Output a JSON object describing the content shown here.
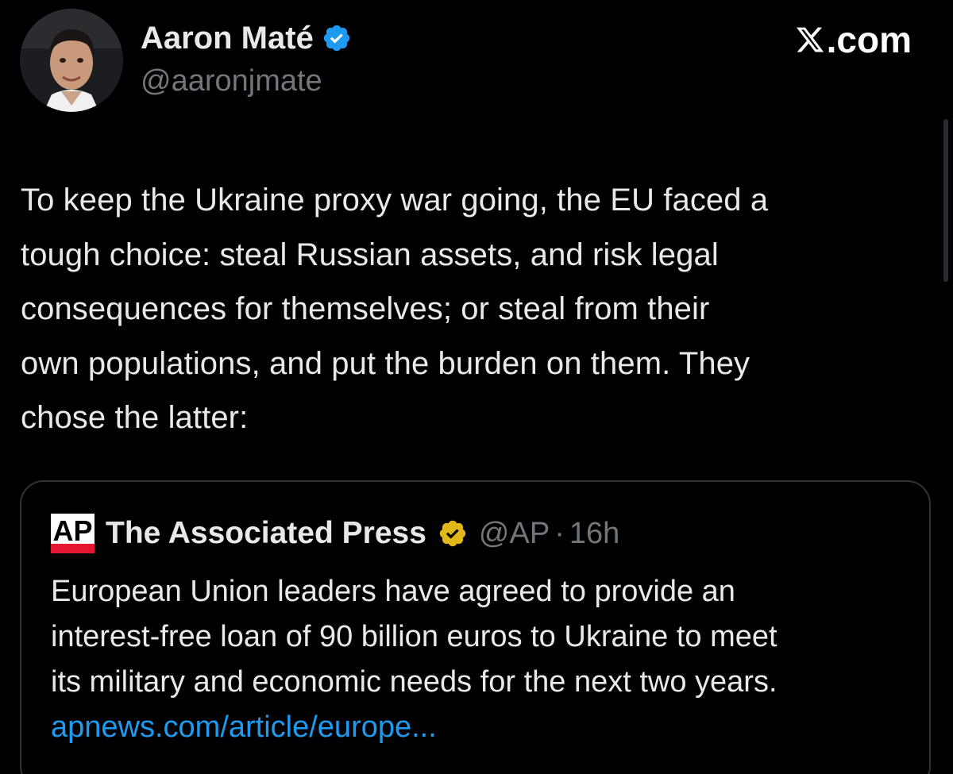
{
  "author": {
    "display_name": "Aaron Maté",
    "handle": "@aaronjmate",
    "avatar_icon": "profile-photo",
    "verified_icon": "verified-badge-icon",
    "verified_color": "#1d9bf0"
  },
  "brand": {
    "logo_icon": "x-logo-icon",
    "label": ".com"
  },
  "tweet": {
    "lines": [
      "To keep the Ukraine proxy war going, the EU faced a",
      "tough choice: steal Russian assets, and risk legal",
      "consequences for themselves; or steal from their",
      "own populations, and put the burden on them. They",
      "chose the latter:"
    ]
  },
  "quote": {
    "logo_icon": "ap-logo-icon",
    "logo_text": "AP",
    "display_name": "The Associated Press",
    "verified_icon": "gold-verified-badge-icon",
    "verified_color": "#e2b719",
    "handle": "@AP",
    "separator": "·",
    "time": "16h",
    "lines": [
      "European Union leaders have agreed to provide an",
      "interest-free loan of 90 billion euros to Ukraine to meet",
      "its military and economic needs for the next two years."
    ],
    "link": "apnews.com/article/europe...",
    "link_color": "#1d9bf0"
  },
  "colors": {
    "background": "#000000",
    "text": "#e7e9ea",
    "muted": "#71767b",
    "border": "#2f3336"
  }
}
